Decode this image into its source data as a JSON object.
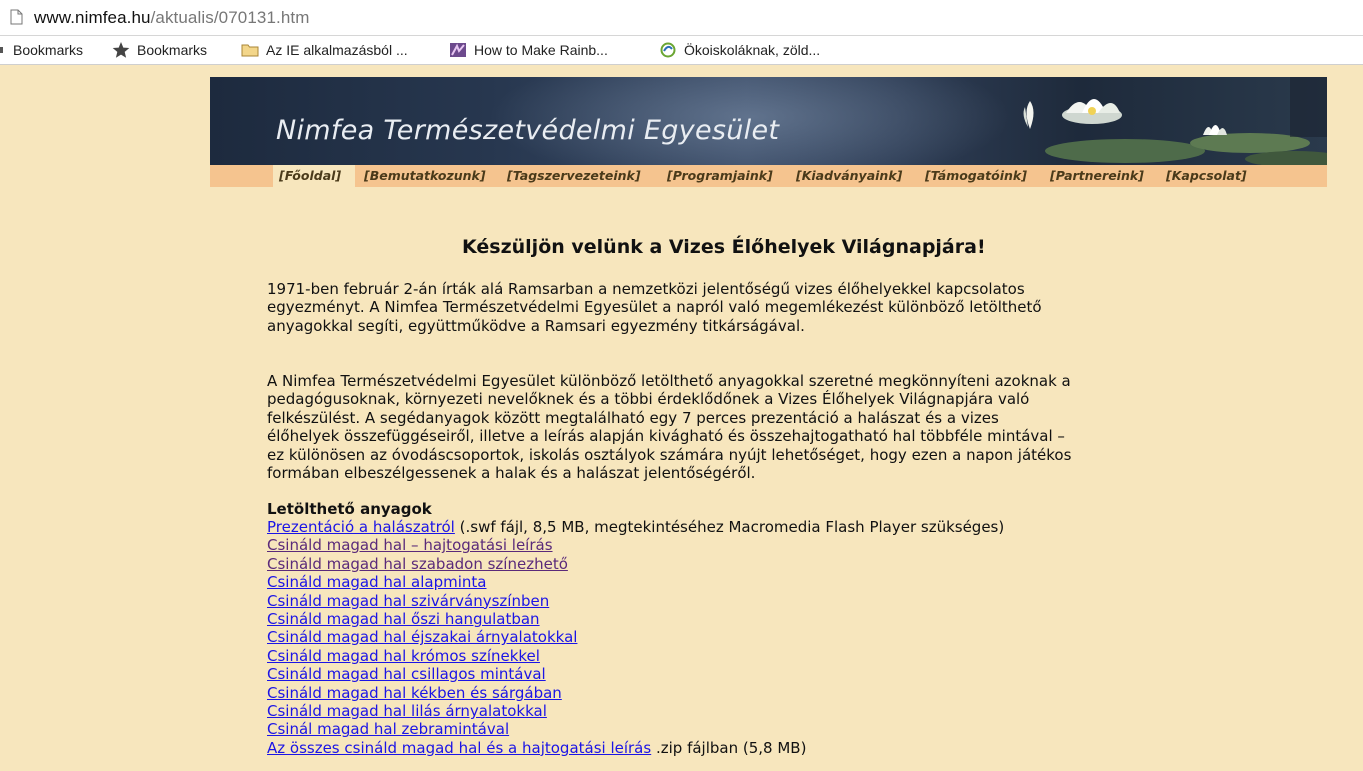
{
  "browser": {
    "url_host": "www.nimfea.hu",
    "url_path": "/aktualis/070131.htm",
    "bookmarks": [
      {
        "label": "Bookmarks",
        "icon": "bookmarks-menu-icon"
      },
      {
        "label": "Bookmarks",
        "icon": "star-icon"
      },
      {
        "label": "Az IE alkalmazásból ...",
        "icon": "folder-icon"
      },
      {
        "label": "How to Make Rainb...",
        "icon": "site-favicon"
      },
      {
        "label": "Ökoiskoláknak, zöld...",
        "icon": "eco-favicon"
      }
    ]
  },
  "banner": {
    "title": "Nimfea Természetvédelmi Egyesület"
  },
  "nav": [
    {
      "label": "[Főoldal]",
      "active": true
    },
    {
      "label": "[Bemutatkozunk]"
    },
    {
      "label": "[Tagszervezeteink]"
    },
    {
      "label": "[Programjaink]"
    },
    {
      "label": "[Kiadványaink]"
    },
    {
      "label": "[Támogatóink]"
    },
    {
      "label": "[Partnereink]"
    },
    {
      "label": "[Kapcsolat]"
    }
  ],
  "article": {
    "headline": "Készüljön velünk a Vizes Élőhelyek Világnapjára!",
    "paragraph1_lines": [
      "1971-ben február 2-án írták alá Ramsarban a nemzetközi jelentőségű vizes élőhelyekkel kapcsolatos",
      "egyezményt. A Nimfea Természetvédelmi Egyesület a napról való megemlékezést különböző letölthető",
      "anyagokkal segíti, együttműködve a Ramsari egyezmény titkárságával."
    ],
    "paragraph2_lines": [
      "A Nimfea Természetvédelmi Egyesület különböző letölthető anyagokkal szeretné megkönnyíteni azoknak a",
      "pedagógusoknak, környezeti nevelőknek és a többi érdeklődőnek a Vizes Élőhelyek Világnapjára való",
      "felkészülést. A segédanyagok között megtalálható egy 7 perces prezentáció a halászat és a vizes",
      "élőhelyek összefüggéseiről, illetve a leírás alapján kivágható és összehajtogatható hal többféle mintával –",
      "ez különösen az óvodáscsoportok, iskolás osztályok számára nyújt lehetőséget, hogy ezen a napon játékos",
      "formában elbeszélgessenek a halak és a halászat jelentőségéről."
    ],
    "downloads_title": "Letölthető anyagok",
    "downloads": [
      {
        "link": "Prezentáció a halászatról",
        "suffix": " (.swf fájl, 8,5 MB, megtekintéséhez Macromedia Flash Player szükséges)",
        "visited": false
      },
      {
        "link": "Csináld magad hal – hajtogatási leírás",
        "suffix": "",
        "visited": true
      },
      {
        "link": "Csináld magad hal szabadon színezhető",
        "suffix": "",
        "visited": true
      },
      {
        "link": "Csináld magad hal alapminta",
        "suffix": "",
        "visited": false
      },
      {
        "link": "Csináld magad hal szivárványszínben",
        "suffix": "",
        "visited": false
      },
      {
        "link": "Csináld magad hal őszi hangulatban",
        "suffix": "",
        "visited": false
      },
      {
        "link": "Csináld magad hal éjszakai árnyalatokkal",
        "suffix": "",
        "visited": false
      },
      {
        "link": "Csináld magad hal krómos színekkel",
        "suffix": "",
        "visited": false
      },
      {
        "link": "Csináld magad hal csillagos mintával",
        "suffix": "",
        "visited": false
      },
      {
        "link": "Csináld magad hal kékben és sárgában",
        "suffix": "",
        "visited": false
      },
      {
        "link": "Csináld magad hal lilás árnyalatokkal",
        "suffix": "",
        "visited": false
      },
      {
        "link": "Csinál magad hal zebramintával",
        "suffix": "",
        "visited": false
      },
      {
        "link": "Az összes csináld magad hal és a hajtogatási leírás",
        "suffix": " .zip fájlban (5,8 MB)",
        "visited": false
      }
    ]
  },
  "colors": {
    "page_background": "#f7e6bd",
    "nav_background": "#f5c48f",
    "link": "#1b14e6",
    "visited_link": "#5a2a7a"
  }
}
